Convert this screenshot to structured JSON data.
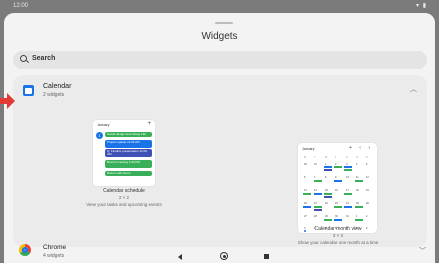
{
  "status_bar": {
    "time": "12:00",
    "system_icons": "▾ ▮"
  },
  "sheet": {
    "title": "Widgets"
  },
  "search": {
    "label": "Search"
  },
  "apps": [
    {
      "name": "Calendar",
      "count": "2 widgets",
      "expanded": true,
      "widgets": [
        {
          "name": "Calendar schedule",
          "size": "2 × 2",
          "description": "View your tasks and upcoming events",
          "preview": {
            "month": "January",
            "day": "1",
            "events": [
              {
                "text": "Social design team Deep Life",
                "color": "#3aaf5a"
              },
              {
                "text": "Project update 11:00 AM",
                "color": "#1a73e8"
              },
              {
                "text": "Q. Finalize presentation 12:00 AM",
                "color": "#3f51b5"
              },
              {
                "text": "Brunch meeting 1:00 PM",
                "color": "#3aaf5a"
              },
              {
                "text": "Dinner with Amos",
                "color": "#3aaf5a"
              }
            ]
          }
        },
        {
          "name": "Calendar month view",
          "size": "3 × 3",
          "description": "Show your calendar one month at a time",
          "preview": {
            "month": "January",
            "controls": "+ ‹ ›"
          }
        }
      ]
    },
    {
      "name": "Chrome",
      "count": "4 widgets",
      "expanded": false
    }
  ],
  "colors": {
    "accent": "#1a73e8",
    "event_green": "#3aaf5a",
    "event_indigo": "#3f51b5",
    "annotation_red": "#e53935"
  },
  "icons": {
    "search": "search-icon",
    "calendar": "calendar-app-icon",
    "chrome": "chrome-app-icon",
    "expand": "chevron-up-icon",
    "collapse": "chevron-down-icon"
  }
}
